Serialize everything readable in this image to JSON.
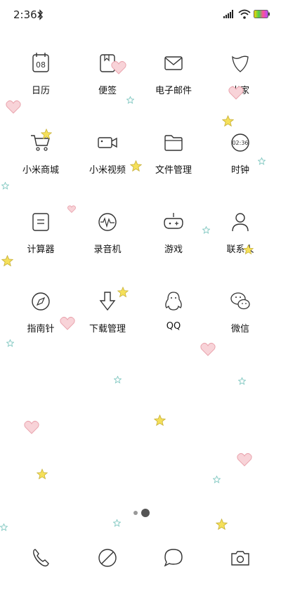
{
  "status": {
    "time": "2:36"
  },
  "apps": [
    {
      "label": "日历",
      "icon": "calendar-icon",
      "date": "08"
    },
    {
      "label": "便签",
      "icon": "notes-icon"
    },
    {
      "label": "电子邮件",
      "icon": "mail-icon"
    },
    {
      "label": "米家",
      "icon": "mijia-icon"
    },
    {
      "label": "小米商城",
      "icon": "shopping-cart-icon"
    },
    {
      "label": "小米视频",
      "icon": "video-camera-icon"
    },
    {
      "label": "文件管理",
      "icon": "folder-icon"
    },
    {
      "label": "时钟",
      "icon": "clock-icon",
      "clock": "02:36"
    },
    {
      "label": "计算器",
      "icon": "calculator-icon"
    },
    {
      "label": "录音机",
      "icon": "recorder-icon"
    },
    {
      "label": "游戏",
      "icon": "gamepad-icon"
    },
    {
      "label": "联系人",
      "icon": "contact-icon"
    },
    {
      "label": "指南针",
      "icon": "compass-icon"
    },
    {
      "label": "下载管理",
      "icon": "download-icon"
    },
    {
      "label": "QQ",
      "icon": "qq-penguin-icon"
    },
    {
      "label": "微信",
      "icon": "wechat-icon"
    }
  ],
  "dock": [
    {
      "name": "phone",
      "icon": "phone-icon"
    },
    {
      "name": "browser",
      "icon": "browser-icon"
    },
    {
      "name": "messages",
      "icon": "messages-icon"
    },
    {
      "name": "camera",
      "icon": "camera-icon"
    }
  ],
  "pages": {
    "count": 2,
    "current": 2
  },
  "colors": {
    "heart": "#f6c1c8",
    "star": "#f5d94a",
    "small_star": "#7fc7c0"
  }
}
